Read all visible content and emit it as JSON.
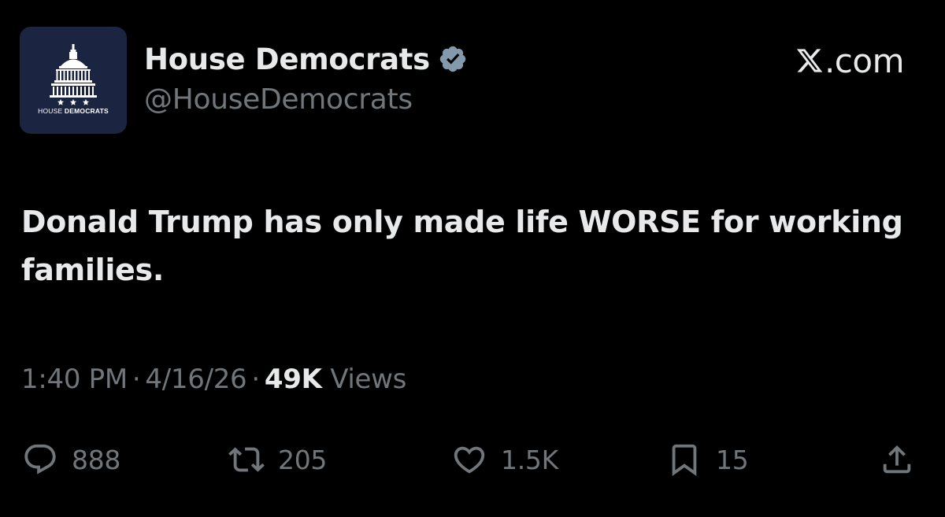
{
  "account": {
    "name": "House Democrats",
    "handle": "@HouseDemocrats",
    "avatar_text_light": "HOUSE",
    "avatar_text_bold": "DEMOCRATS",
    "verified_icon": "verified-badge-icon"
  },
  "brand": {
    "logo_icon": "x-logo-icon",
    "suffix": ".com"
  },
  "post": {
    "text": "Donald Trump has only made life WORSE for working families.",
    "time": "1:40 PM",
    "date": "4/16/26",
    "views_count": "49K",
    "views_label": "Views",
    "separator": "·"
  },
  "actions": {
    "replies": "888",
    "reposts": "205",
    "likes": "1.5K",
    "bookmarks": "15"
  },
  "colors": {
    "background": "#000000",
    "primary_text": "#e7e9ea",
    "secondary_text": "#71767b",
    "verified_badge": "#829aab",
    "avatar_background": "#1b2440"
  }
}
